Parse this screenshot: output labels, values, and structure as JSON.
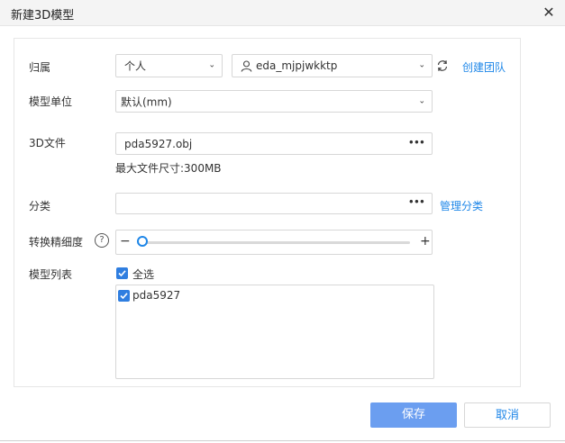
{
  "dialog": {
    "title": "新建3D模型"
  },
  "form": {
    "owner": {
      "label": "归属",
      "scope_value": "个人",
      "user_value": "eda_mjpjwkktp",
      "refresh_icon": "refresh-icon",
      "create_team_link": "创建团队"
    },
    "unit": {
      "label": "模型单位",
      "value": "默认(mm)"
    },
    "file": {
      "label": "3D文件",
      "value": "pda5927.obj",
      "hint": "最大文件尺寸:300MB"
    },
    "category": {
      "label": "分类",
      "value": "",
      "manage_link": "管理分类"
    },
    "precision": {
      "label": "转换精细度",
      "help": "?",
      "minus": "−",
      "plus": "+",
      "level": 0
    },
    "model_list": {
      "label": "模型列表",
      "select_all": "全选",
      "items": [
        {
          "name": "pda5927",
          "checked": true
        }
      ]
    }
  },
  "footer": {
    "save_label": "保存",
    "cancel_label": "取消"
  },
  "colors": {
    "accent": "#1f87e8",
    "save_bg": "#6b9ef0",
    "checkbox": "#2f7ee0"
  }
}
